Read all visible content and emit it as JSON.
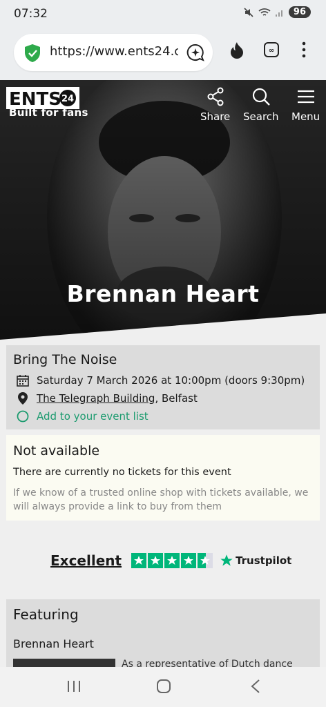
{
  "status": {
    "time": "07:32",
    "battery": "96"
  },
  "browser": {
    "url": "https://www.ents24.c"
  },
  "header": {
    "logo_text": "ENTS",
    "logo_badge": "24",
    "tagline": "Built for fans",
    "share_label": "Share",
    "search_label": "Search",
    "menu_label": "Menu",
    "artist_name": "Brennan Heart"
  },
  "event": {
    "title": "Bring The Noise",
    "datetime": "Saturday 7 March 2026 at 10:00pm (doors 9:30pm)",
    "venue": "The Telegraph Building",
    "city": ", Belfast",
    "add_label": "Add to your event list"
  },
  "availability": {
    "title": "Not available",
    "line": "There are currently no tickets for this event",
    "sub": "If we know of a trusted online shop with tickets available, we will always provide a link to buy from them"
  },
  "trustpilot": {
    "rating_word": "Excellent",
    "brand": "Trustpilot",
    "stars": 4.5
  },
  "featuring": {
    "title": "Featuring",
    "artist": "Brennan Heart",
    "desc": "As a representative of Dutch dance"
  }
}
